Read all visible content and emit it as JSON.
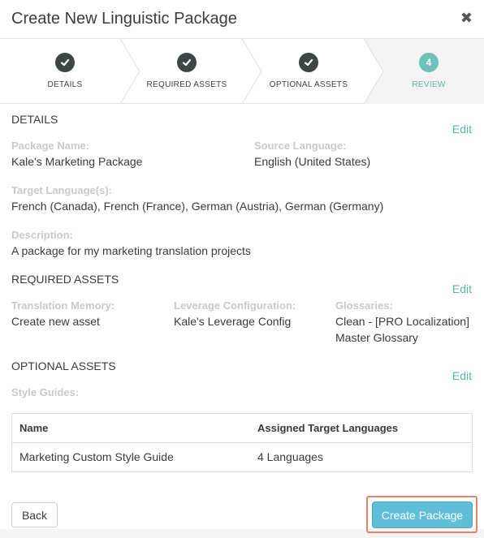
{
  "dialog": {
    "title": "Create New Linguistic Package",
    "close_glyph": "✖"
  },
  "steps": [
    {
      "label": "DETAILS",
      "state": "done"
    },
    {
      "label": "REQUIRED ASSETS",
      "state": "done"
    },
    {
      "label": "OPTIONAL ASSETS",
      "state": "done"
    },
    {
      "label": "REVIEW",
      "state": "active",
      "number": "4"
    }
  ],
  "details": {
    "title": "DETAILS",
    "edit": "Edit",
    "package_name_label": "Package Name:",
    "package_name": "Kale's Marketing Package",
    "source_language_label": "Source Language:",
    "source_language": "English (United States)",
    "target_languages_label": "Target Language(s):",
    "target_languages": "French (Canada), French (France), German (Austria), German (Germany)",
    "description_label": "Description:",
    "description": "A package for my marketing translation projects"
  },
  "required_assets": {
    "title": "REQUIRED ASSETS",
    "edit": "Edit",
    "tm_label": "Translation Memory:",
    "tm_value": "Create new asset",
    "leverage_label": "Leverage Configuration:",
    "leverage_value": "Kale's Leverage Config",
    "glossaries_label": "Glossaries:",
    "glossaries_line1": "Clean - [PRO Localization]",
    "glossaries_line2": "Master Glossary"
  },
  "optional_assets": {
    "title": "OPTIONAL ASSETS",
    "edit": "Edit",
    "style_guides_label": "Style Guides:",
    "table": {
      "headers": [
        "Name",
        "Assigned Target Languages"
      ],
      "rows": [
        [
          "Marketing Custom Style Guide",
          "4 Languages"
        ]
      ]
    }
  },
  "footer": {
    "back": "Back",
    "create": "Create Package"
  },
  "colors": {
    "accent": "#5fb3a8",
    "primary_button": "#5fbfd9",
    "highlight": "#e8836a",
    "done_circle": "#3d4545"
  }
}
